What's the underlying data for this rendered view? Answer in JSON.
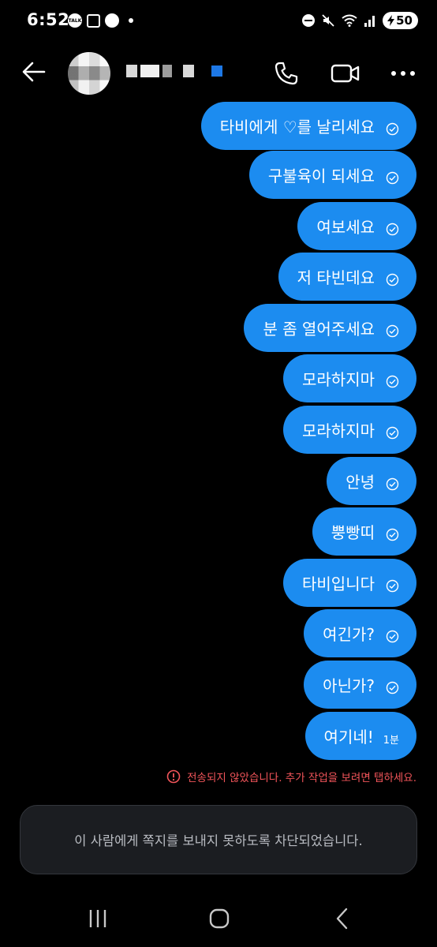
{
  "status_bar": {
    "time": "6:52",
    "talk_label": "TALK",
    "battery": "50"
  },
  "header": {
    "icons": [
      "back-arrow-icon",
      "phone-icon",
      "video-camera-icon",
      "more-dots-icon"
    ]
  },
  "messages": [
    {
      "text": "타비에게 ♡를 날리세요",
      "status": "sent"
    },
    {
      "text": "구불육이 되세요",
      "status": "sent"
    },
    {
      "text": "여보세요",
      "status": "sent"
    },
    {
      "text": "저 타빈데요",
      "status": "sent"
    },
    {
      "text": "분 좀 열어주세요",
      "status": "sent"
    },
    {
      "text": "모라하지마",
      "status": "sent"
    },
    {
      "text": "모라하지마",
      "status": "sent"
    },
    {
      "text": "안녕",
      "status": "sent"
    },
    {
      "text": "뿡빵띠",
      "status": "sent"
    },
    {
      "text": "타비입니다",
      "status": "sent"
    },
    {
      "text": "여긴가?",
      "status": "sent"
    },
    {
      "text": "아닌가?",
      "status": "sent"
    },
    {
      "text": "여기네!",
      "time": "1분"
    }
  ],
  "error_notice": "전송되지 않았습니다. 추가 작업을 보려면 탭하세요.",
  "blocked_notice": "이 사람에게 쪽지를 보내지 못하도록 차단되었습니다.",
  "colors": {
    "bubble": "#1c8cf0",
    "error": "#f2555a",
    "background": "#000000"
  }
}
